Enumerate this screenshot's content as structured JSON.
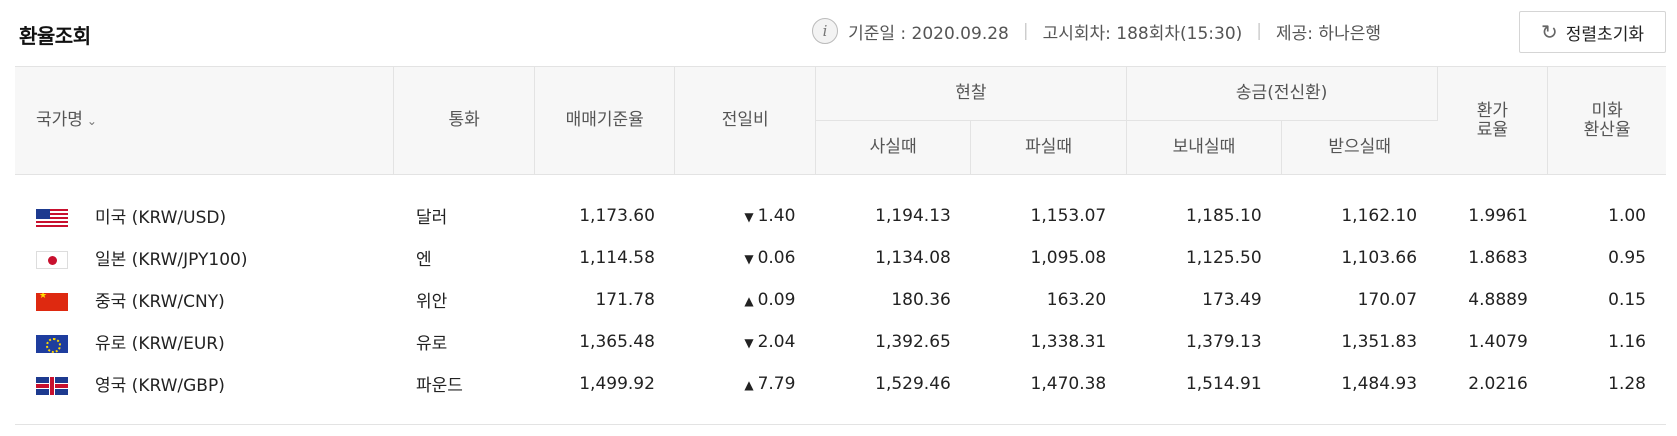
{
  "header": {
    "title": "환율조회",
    "base_date": "기준일 : 2020.09.28",
    "notice": "고시회차: 188회차(15:30)",
    "provider": "제공: 하나은행",
    "reset_label": "정렬초기화"
  },
  "columns": {
    "country": "국가명",
    "currency": "통화",
    "base_rate": "매매기준율",
    "change": "전일비",
    "cash": "현찰",
    "cash_buy": "사실때",
    "cash_sell": "파실때",
    "transfer": "송금(전신환)",
    "send": "보내실때",
    "receive": "받으실때",
    "fee_rate_1": "환가",
    "fee_rate_2": "료율",
    "usd_rate_1": "미화",
    "usd_rate_2": "환산율"
  },
  "rows": [
    {
      "flag": "us-flag",
      "country": "미국 (KRW/USD)",
      "currency": "달러",
      "base_rate": "1,173.60",
      "direction": "down",
      "change": "1.40",
      "cash_buy": "1,194.13",
      "cash_sell": "1,153.07",
      "send": "1,185.10",
      "receive": "1,162.10",
      "fee_rate": "1.9961",
      "usd_rate": "1.00"
    },
    {
      "flag": "jp-flag",
      "country": "일본 (KRW/JPY100)",
      "currency": "엔",
      "base_rate": "1,114.58",
      "direction": "down",
      "change": "0.06",
      "cash_buy": "1,134.08",
      "cash_sell": "1,095.08",
      "send": "1,125.50",
      "receive": "1,103.66",
      "fee_rate": "1.8683",
      "usd_rate": "0.95"
    },
    {
      "flag": "cn-flag",
      "country": "중국 (KRW/CNY)",
      "currency": "위안",
      "base_rate": "171.78",
      "direction": "up",
      "change": "0.09",
      "cash_buy": "180.36",
      "cash_sell": "163.20",
      "send": "173.49",
      "receive": "170.07",
      "fee_rate": "4.8889",
      "usd_rate": "0.15"
    },
    {
      "flag": "eu-flag",
      "country": "유로 (KRW/EUR)",
      "currency": "유로",
      "base_rate": "1,365.48",
      "direction": "down",
      "change": "2.04",
      "cash_buy": "1,392.65",
      "cash_sell": "1,338.31",
      "send": "1,379.13",
      "receive": "1,351.83",
      "fee_rate": "1.4079",
      "usd_rate": "1.16"
    },
    {
      "flag": "gb-flag",
      "country": "영국 (KRW/GBP)",
      "currency": "파운드",
      "base_rate": "1,499.92",
      "direction": "up",
      "change": "7.79",
      "cash_buy": "1,529.46",
      "cash_sell": "1,470.38",
      "send": "1,514.91",
      "receive": "1,484.93",
      "fee_rate": "2.0216",
      "usd_rate": "1.28"
    }
  ],
  "colors": {
    "down": "#1e5fd6",
    "up": "#e02020",
    "header_bg": "#f7f7f7",
    "border": "#e3e3e3"
  }
}
